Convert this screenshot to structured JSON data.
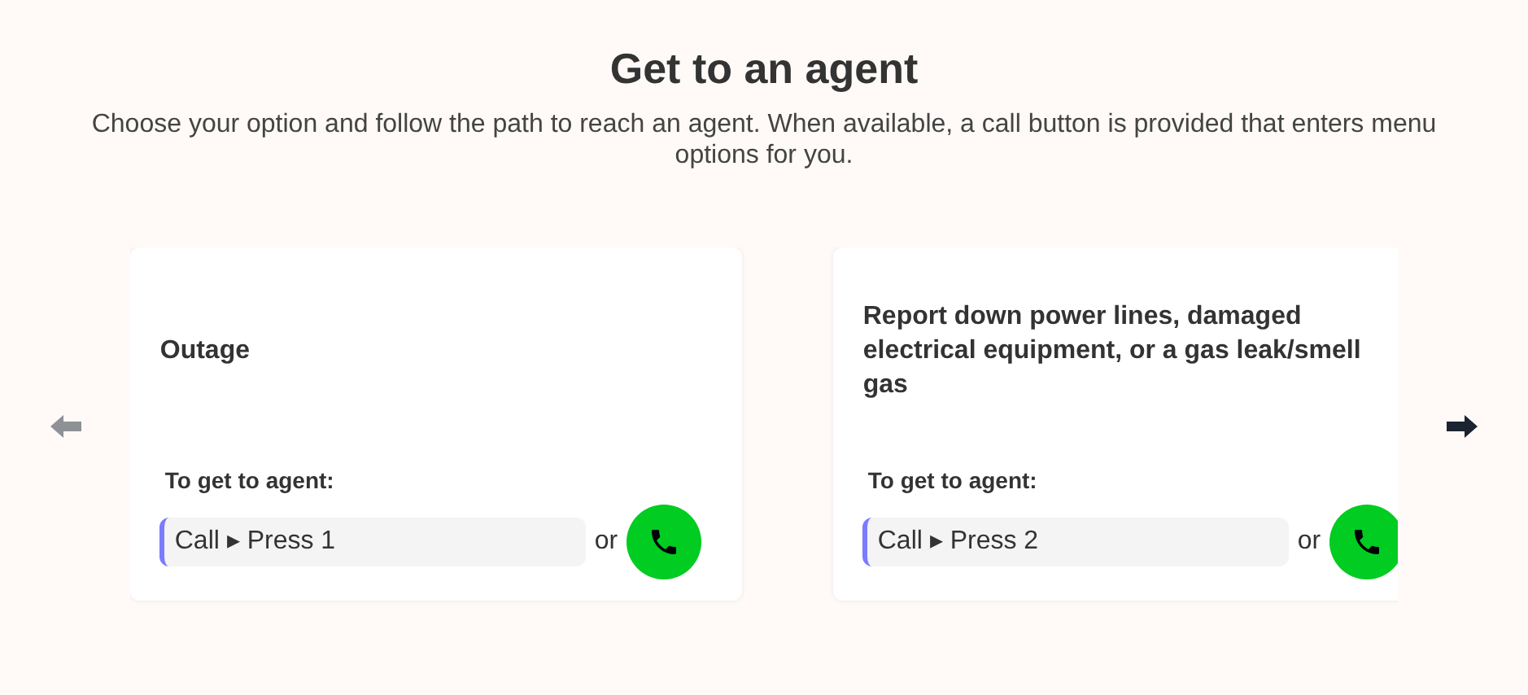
{
  "heading": "Get to an agent",
  "intro": "Choose your option and follow the path to reach an agent. When available, a call button is provided that enters menu options for you.",
  "carousel": {
    "prev": {
      "disabled": true
    },
    "next": {
      "disabled": false
    },
    "cards": [
      {
        "title": "Outage",
        "path_label": "To get to agent:",
        "path": "Call ▸ Press 1",
        "or": "or"
      },
      {
        "title": "Report down power lines, damaged electrical equipment, or a gas leak/smell gas",
        "path_label": "To get to agent:",
        "path": "Call ▸ Press 2",
        "or": "or"
      }
    ]
  }
}
